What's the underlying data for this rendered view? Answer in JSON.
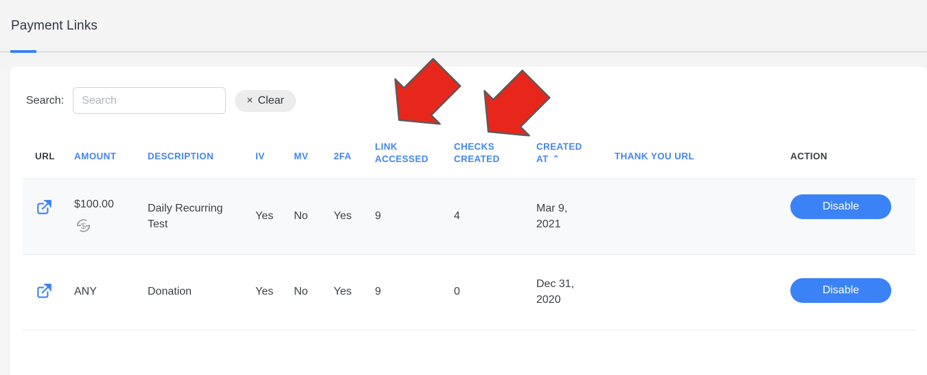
{
  "page": {
    "title": "Payment Links",
    "accent_color": "#3b82f6",
    "header_link_color": "#4285f4",
    "annotation_color": "#e8271c"
  },
  "search": {
    "label": "Search:",
    "value": "",
    "placeholder": "Search",
    "clear_label": "Clear",
    "clear_x": "×"
  },
  "table": {
    "columns": [
      {
        "key": "url",
        "label": "URL",
        "sortable": false
      },
      {
        "key": "amount",
        "label": "AMOUNT",
        "sortable": true
      },
      {
        "key": "description",
        "label": "DESCRIPTION",
        "sortable": true
      },
      {
        "key": "iv",
        "label": "IV",
        "sortable": true
      },
      {
        "key": "mv",
        "label": "MV",
        "sortable": true
      },
      {
        "key": "twofa",
        "label": "2FA",
        "sortable": true
      },
      {
        "key": "link_accessed",
        "label": "LINK ACCESSED",
        "line1": "LINK",
        "line2": "ACCESSED",
        "sortable": true
      },
      {
        "key": "checks_created",
        "label": "CHECKS CREATED",
        "line1": "CHECKS",
        "line2": "CREATED",
        "sortable": true
      },
      {
        "key": "created_at",
        "label": "CREATED AT",
        "line1": "CREATED",
        "line2": "AT",
        "sortable": true,
        "sort_caret": "⌃"
      },
      {
        "key": "thank_you_url",
        "label": "THANK YOU URL",
        "sortable": true
      },
      {
        "key": "action",
        "label": "ACTION",
        "sortable": false
      }
    ],
    "rows": [
      {
        "url_icon": "external-link-icon",
        "amount": "$100.00",
        "amount_badge_icon": "recurring-payment-icon",
        "description": "Daily Recurring Test",
        "iv": "Yes",
        "mv": "No",
        "twofa": "Yes",
        "link_accessed": "9",
        "checks_created": "4",
        "created_at_line1": "Mar 9,",
        "created_at_line2": "2021",
        "thank_you_url": "",
        "action_label": "Disable"
      },
      {
        "url_icon": "external-link-icon",
        "amount": "ANY",
        "amount_badge_icon": "",
        "description": "Donation",
        "iv": "Yes",
        "mv": "No",
        "twofa": "Yes",
        "link_accessed": "9",
        "checks_created": "0",
        "created_at_line1": "Dec 31,",
        "created_at_line2": "2020",
        "thank_you_url": "",
        "action_label": "Disable"
      }
    ]
  },
  "annotations": [
    {
      "name": "arrow-link-accessed",
      "direction": "down-left"
    },
    {
      "name": "arrow-checks-created",
      "direction": "down-left"
    }
  ]
}
